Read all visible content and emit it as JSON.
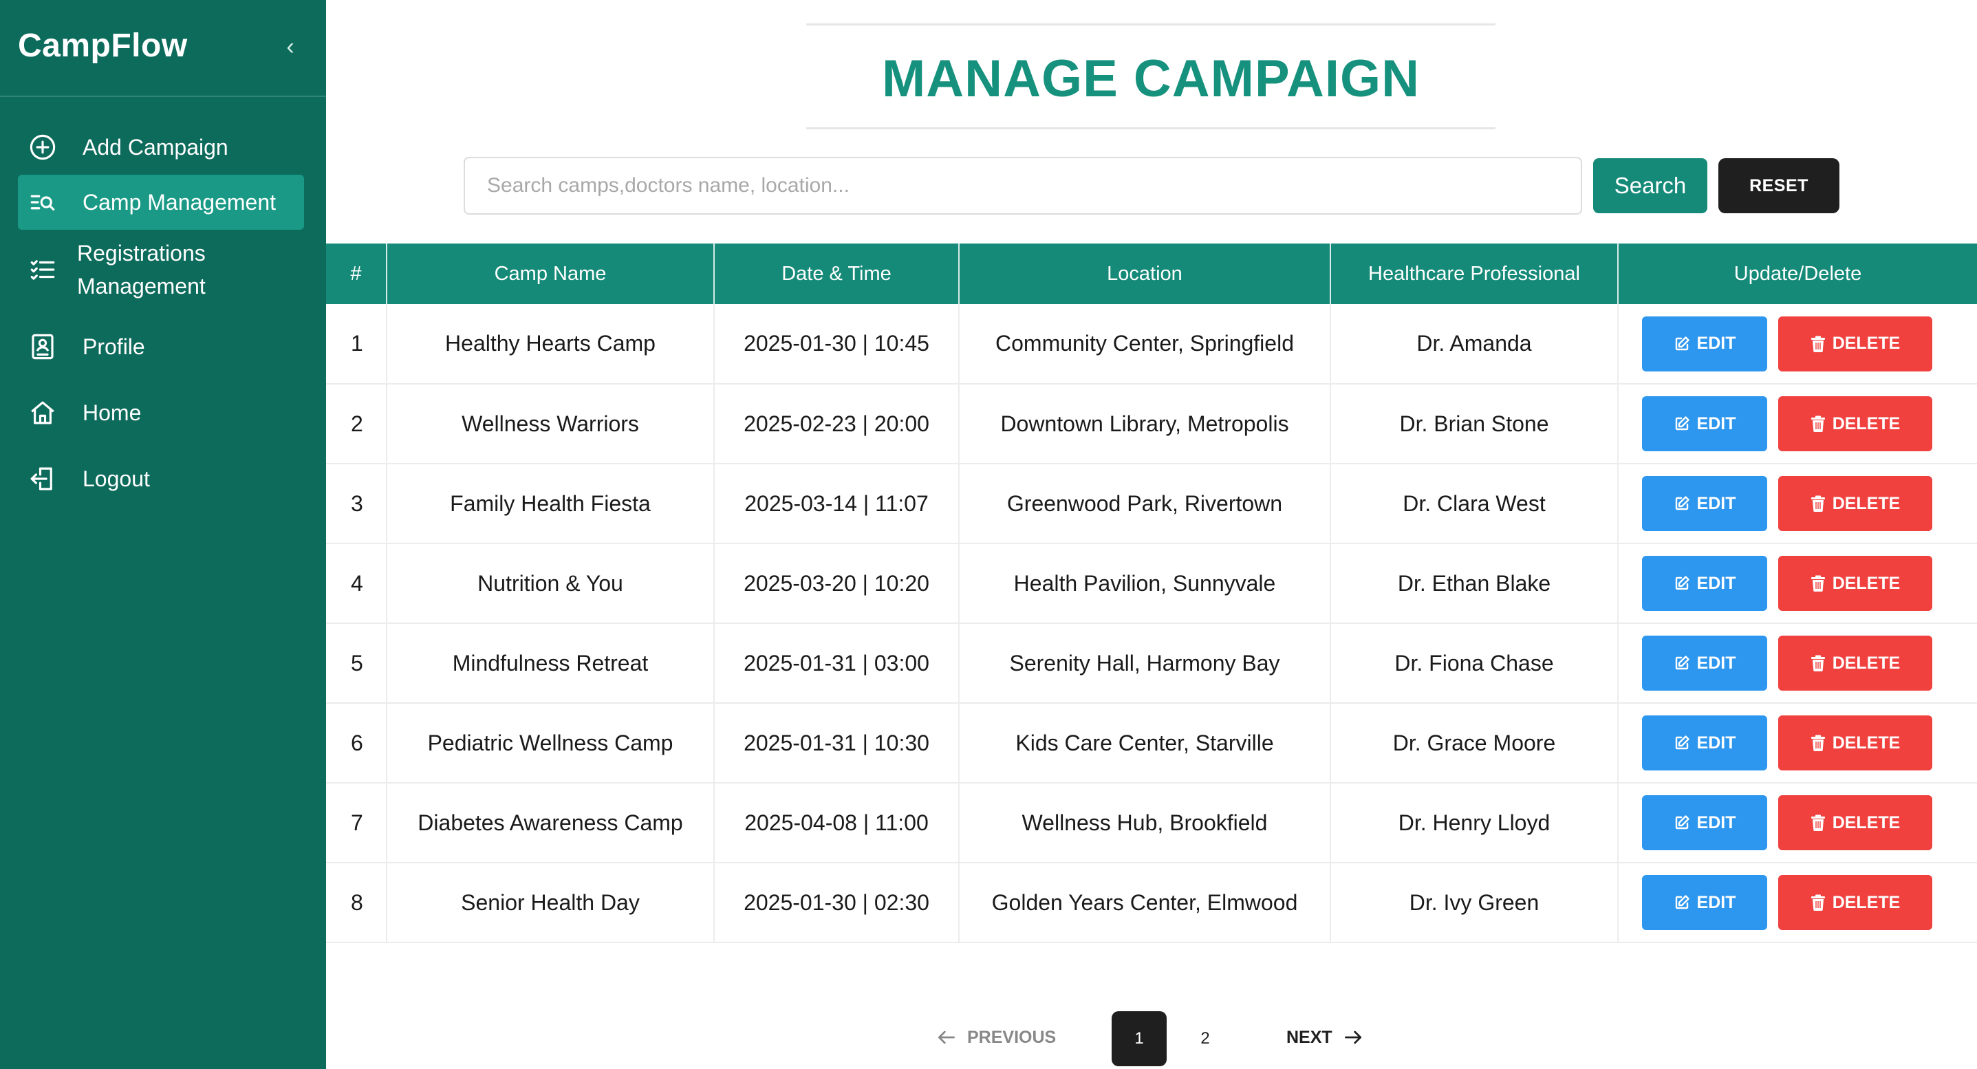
{
  "app": {
    "brand": "CampFlow",
    "collapse_icon": "chevron-left-icon"
  },
  "sidebar": {
    "items": [
      {
        "label": "Add Campaign",
        "icon": "plus-circle-icon",
        "active": false
      },
      {
        "label": "Camp Management",
        "icon": "list-search-icon",
        "active": true
      },
      {
        "label": "Registrations Management",
        "icon": "checklist-icon",
        "active": false
      },
      {
        "label": "Profile",
        "icon": "profile-card-icon",
        "active": false
      },
      {
        "label": "Home",
        "icon": "home-icon",
        "active": false
      },
      {
        "label": "Logout",
        "icon": "logout-icon",
        "active": false
      }
    ]
  },
  "main": {
    "title": "MANAGE CAMPAIGN",
    "search": {
      "placeholder": "Search camps,doctors name, location...",
      "value": "",
      "button_label": "Search",
      "reset_label": "RESET"
    },
    "table": {
      "headers": [
        "#",
        "Camp Name",
        "Date & Time",
        "Location",
        "Healthcare Professional",
        "Update/Delete"
      ],
      "edit_label": "EDIT",
      "delete_label": "DELETE",
      "rows": [
        {
          "num": "1",
          "camp": "Healthy Hearts Camp",
          "datetime": "2025-01-30 | 10:45",
          "location": "Community Center, Springfield",
          "professional": "Dr. Amanda"
        },
        {
          "num": "2",
          "camp": "Wellness Warriors",
          "datetime": "2025-02-23 | 20:00",
          "location": "Downtown Library, Metropolis",
          "professional": "Dr. Brian Stone"
        },
        {
          "num": "3",
          "camp": "Family Health Fiesta",
          "datetime": "2025-03-14 | 11:07",
          "location": "Greenwood Park, Rivertown",
          "professional": "Dr. Clara West"
        },
        {
          "num": "4",
          "camp": "Nutrition & You",
          "datetime": "2025-03-20 | 10:20",
          "location": "Health Pavilion, Sunnyvale",
          "professional": "Dr. Ethan Blake"
        },
        {
          "num": "5",
          "camp": "Mindfulness Retreat",
          "datetime": "2025-01-31 | 03:00",
          "location": "Serenity Hall, Harmony Bay",
          "professional": "Dr. Fiona Chase"
        },
        {
          "num": "6",
          "camp": "Pediatric Wellness Camp",
          "datetime": "2025-01-31 | 10:30",
          "location": "Kids Care Center, Starville",
          "professional": "Dr. Grace Moore"
        },
        {
          "num": "7",
          "camp": "Diabetes Awareness Camp",
          "datetime": "2025-04-08 | 11:00",
          "location": "Wellness Hub, Brookfield",
          "professional": "Dr. Henry Lloyd"
        },
        {
          "num": "8",
          "camp": "Senior Health Day",
          "datetime": "2025-01-30 | 02:30",
          "location": "Golden Years Center, Elmwood",
          "professional": "Dr. Ivy Green"
        }
      ]
    },
    "pagination": {
      "previous_label": "PREVIOUS",
      "next_label": "NEXT",
      "pages": [
        "1",
        "2"
      ],
      "current": "1"
    }
  },
  "colors": {
    "sidebar_bg": "#0d6b5c",
    "sidebar_active": "#1a9a86",
    "accent": "#168a78",
    "title": "#16917d",
    "edit": "#2d96ee",
    "delete": "#f0413f",
    "dark": "#1f1f1f"
  }
}
